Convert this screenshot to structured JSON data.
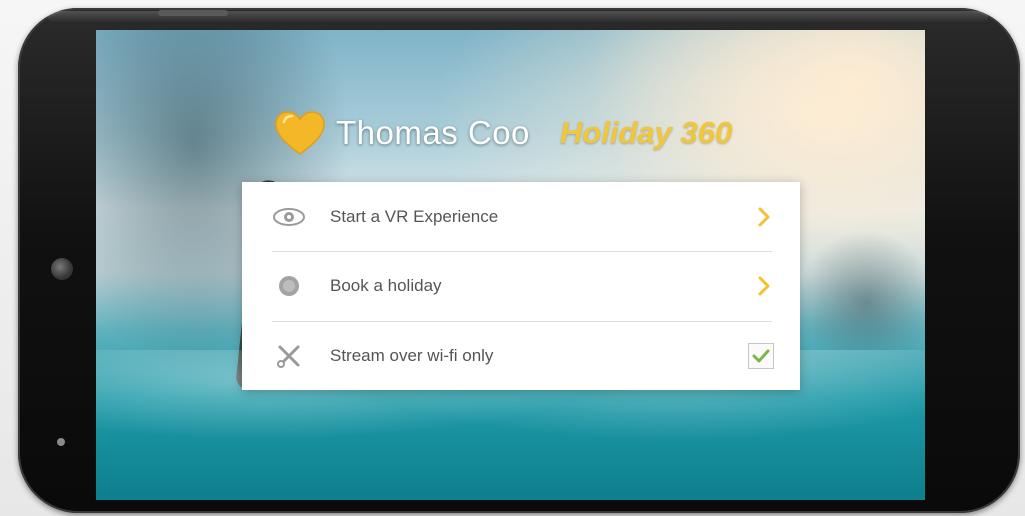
{
  "brand": {
    "name": "Thomas Coo",
    "product": "Holiday 360",
    "accent_color": "#f0c63a",
    "heart_color": "#f4b728"
  },
  "menu": {
    "items": [
      {
        "label": "Start a VR Experience",
        "icon": "eye-icon",
        "action": "chevron-right-icon"
      },
      {
        "label": "Book a holiday",
        "icon": "globe-icon",
        "action": "chevron-right-icon"
      },
      {
        "label": "Stream over wi-fi only",
        "icon": "tools-icon",
        "action": "checkbox",
        "checked": true
      }
    ],
    "chevron_color": "#f2c230",
    "check_color": "#7ab648"
  }
}
